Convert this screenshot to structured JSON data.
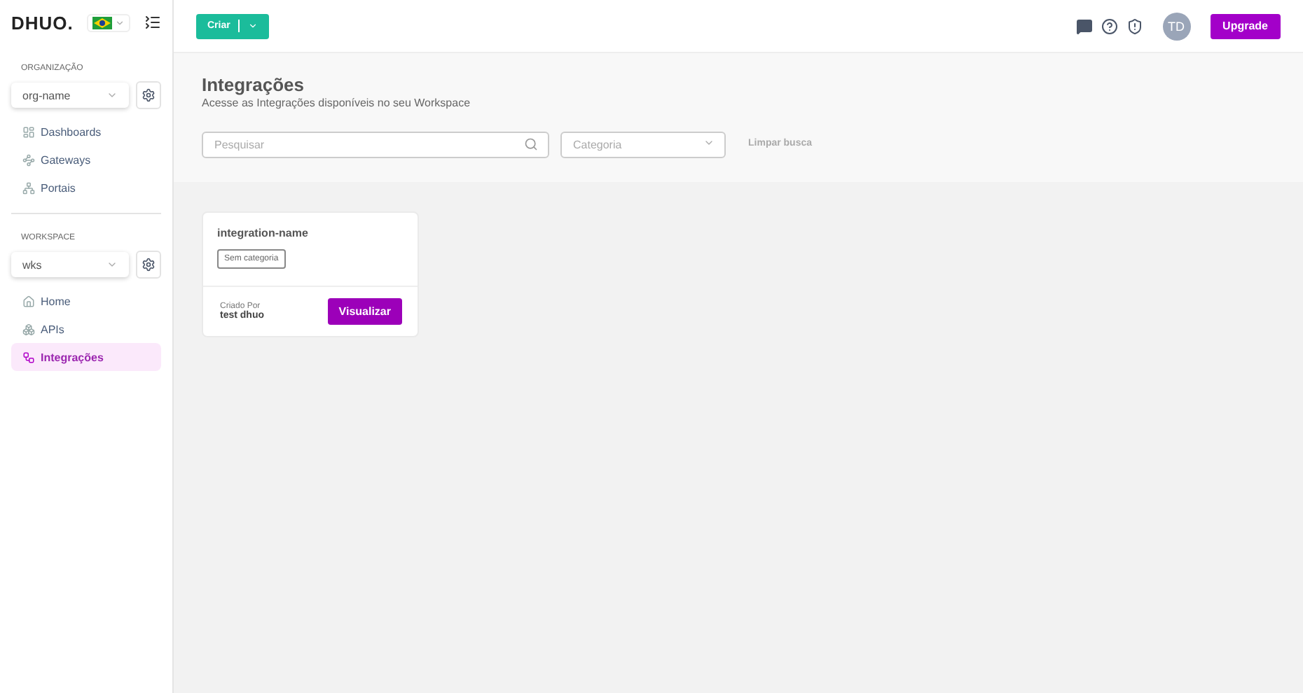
{
  "logo": "DHUO.",
  "sidebar": {
    "sections": [
      {
        "label": "ORGANIZAÇÃO",
        "select": "org-name",
        "items": [
          {
            "label": "Dashboards",
            "selected": false
          },
          {
            "label": "Gateways",
            "selected": false
          },
          {
            "label": "Portais",
            "selected": false
          }
        ]
      },
      {
        "label": "WORKSPACE",
        "select": "wks",
        "items": [
          {
            "label": "Home",
            "selected": false
          },
          {
            "label": "APIs",
            "selected": false
          },
          {
            "label": "Integrações",
            "selected": true
          }
        ]
      }
    ]
  },
  "topbar": {
    "create_button": "Criar",
    "avatar": "TD",
    "upgrade_button": "Upgrade"
  },
  "page": {
    "title": "Integrações",
    "subtitle": "Acesse as Integrações disponíveis no seu Workspace",
    "search": {
      "placeholder": "Pesquisar"
    },
    "category": {
      "placeholder": "Categoria"
    },
    "clear": "Limpar busca"
  },
  "cards": [
    {
      "name": "integration-name",
      "tag": "Sem categoria",
      "created_label": "Criado Por",
      "created_by": "test dhuo",
      "button": "Visualizar"
    }
  ]
}
